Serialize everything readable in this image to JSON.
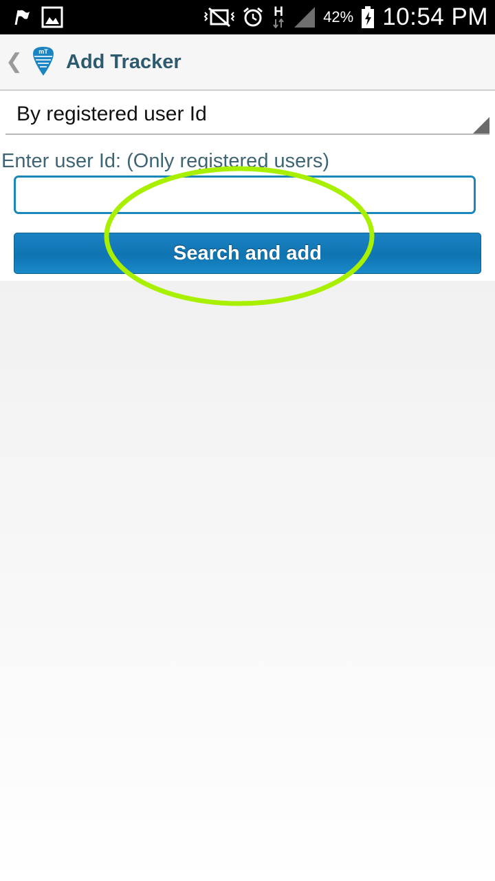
{
  "status_bar": {
    "icons": [
      "flag-icon",
      "gallery-icon",
      "vibrate-icon",
      "alarm-icon",
      "network-h-icon",
      "signal-icon",
      "battery-charging-icon"
    ],
    "network_type": "H",
    "battery_percent": "42%",
    "time": "10:54 PM"
  },
  "action_bar": {
    "title": "Add Tracker",
    "logo_text": "mT"
  },
  "form": {
    "search_mode": "By registered user Id",
    "user_id_label": "Enter user Id: (Only registered users)",
    "user_id_value": "",
    "submit_label": "Search and add"
  },
  "colors": {
    "accent": "#1a87b9",
    "title": "#2d5a6e",
    "annotation": "#a8f000"
  }
}
